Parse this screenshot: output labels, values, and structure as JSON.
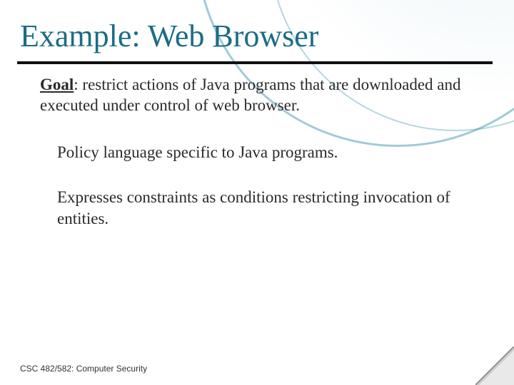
{
  "title": "Example: Web Browser",
  "goal_label": "Goal",
  "goal_text": ": restrict actions of Java programs that are downloaded and executed under control of web browser.",
  "para1": "Policy language specific to Java programs.",
  "para2": "Expresses constraints as conditions restricting invocation of entities.",
  "footer": "CSC 482/582: Computer Security"
}
